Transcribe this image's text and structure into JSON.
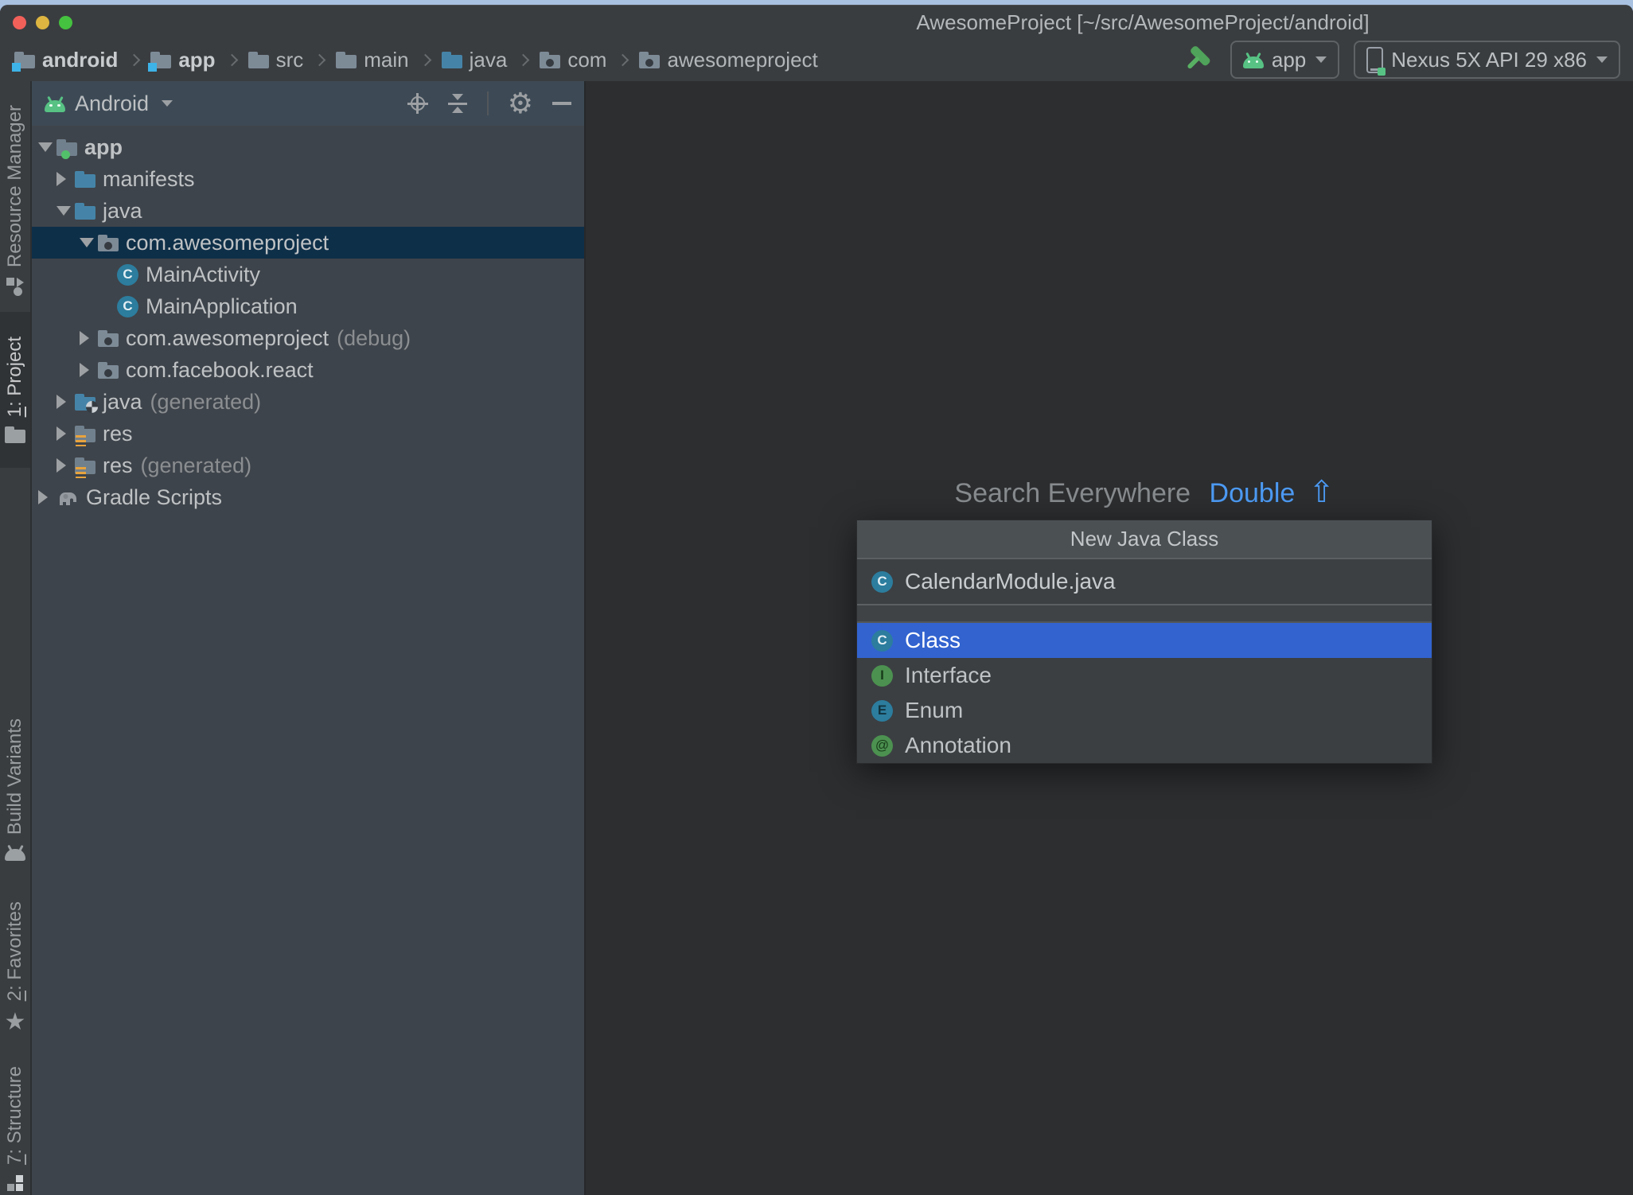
{
  "window": {
    "title": "AwesomeProject [~/src/AwesomeProject/android]"
  },
  "breadcrumb": {
    "items": [
      {
        "label": "android",
        "icon": "module-folder"
      },
      {
        "label": "app",
        "icon": "module-folder"
      },
      {
        "label": "src",
        "icon": "folder"
      },
      {
        "label": "main",
        "icon": "folder"
      },
      {
        "label": "java",
        "icon": "source-folder"
      },
      {
        "label": "com",
        "icon": "package"
      },
      {
        "label": "awesomeproject",
        "icon": "package"
      }
    ]
  },
  "run_toolbar": {
    "config_name": "app",
    "device_name": "Nexus 5X API 29 x86"
  },
  "tool_strip": {
    "resource_manager": {
      "label": "Resource Manager"
    },
    "project": {
      "mnemonic": "1",
      "label": ": Project"
    },
    "build_variants": {
      "label": "Build Variants"
    },
    "favorites": {
      "mnemonic": "2",
      "label": ": Favorites"
    },
    "structure": {
      "mnemonic": "7",
      "label": ": Structure"
    }
  },
  "project_panel": {
    "view_mode": "Android",
    "tree": [
      {
        "label": "app",
        "icon": "module-folder-green-dot"
      },
      {
        "label": "manifests",
        "icon": "blue-folder"
      },
      {
        "label": "java",
        "icon": "blue-folder"
      },
      {
        "label": "com.awesomeproject",
        "icon": "package"
      },
      {
        "label": "MainActivity",
        "icon": "java-class"
      },
      {
        "label": "MainApplication",
        "icon": "java-class"
      },
      {
        "label": "com.awesomeproject",
        "suffix": "(debug)",
        "icon": "package"
      },
      {
        "label": "com.facebook.react",
        "icon": "package"
      },
      {
        "label": "java",
        "suffix": "(generated)",
        "icon": "generated-source-folder"
      },
      {
        "label": "res",
        "icon": "res-folder"
      },
      {
        "label": "res",
        "suffix": "(generated)",
        "icon": "res-folder"
      },
      {
        "label": "Gradle Scripts",
        "icon": "gradle-elephant"
      }
    ]
  },
  "editor": {
    "hint_text": "Search Everywhere",
    "hint_shortcut": "Double",
    "hint_key": "⇧"
  },
  "popup": {
    "title": "New Java Class",
    "input_value": "CalendarModule.java",
    "options": [
      {
        "label": "Class",
        "icon": "class",
        "selected": true
      },
      {
        "label": "Interface",
        "icon": "interface",
        "selected": false
      },
      {
        "label": "Enum",
        "icon": "enum",
        "selected": false
      },
      {
        "label": "Annotation",
        "icon": "annotation",
        "selected": false
      }
    ]
  },
  "colors": {
    "selection_blue": "#3263cf",
    "tree_selection": "#0e2f48",
    "accent_green": "#57c284",
    "hint_blue": "#4d9bf5"
  }
}
